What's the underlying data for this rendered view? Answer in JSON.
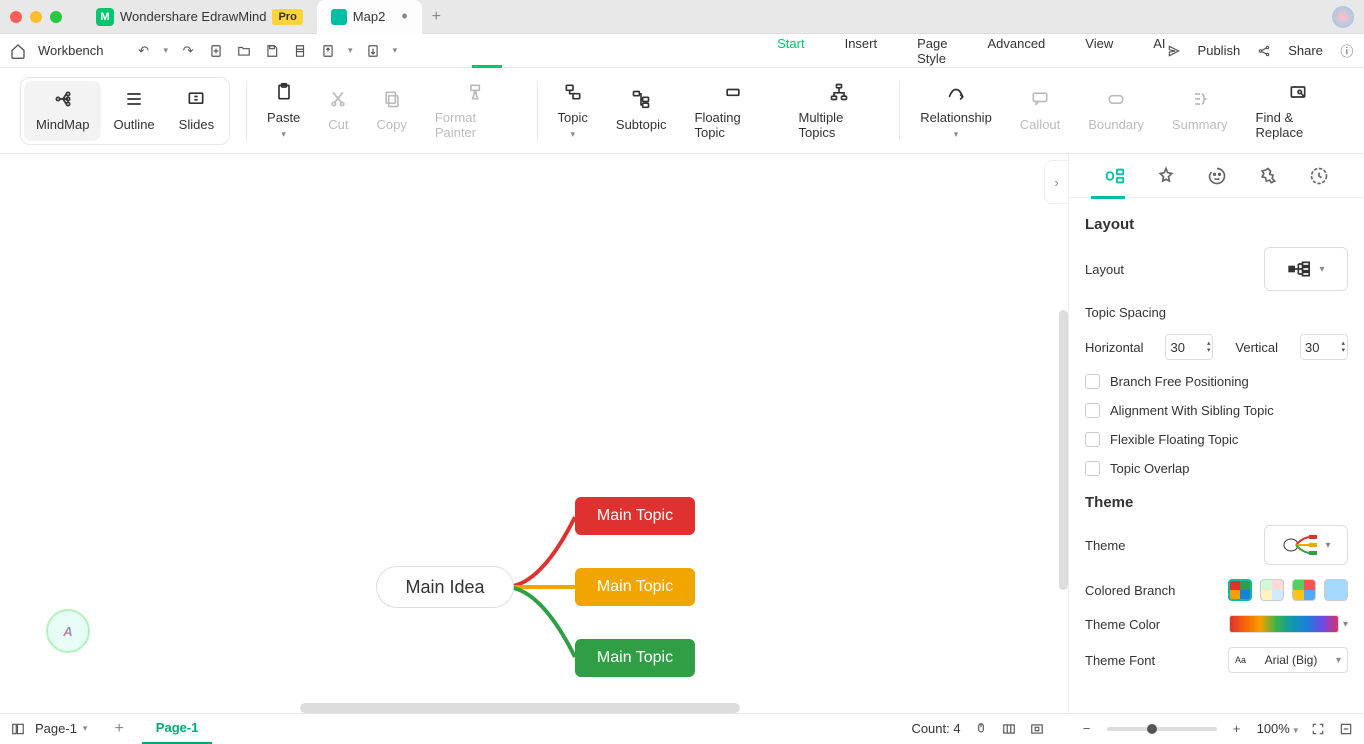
{
  "title": {
    "app": "Wondershare EdrawMind",
    "pro": "Pro",
    "doc": "Map2"
  },
  "topbar": {
    "workbench": "Workbench",
    "publish": "Publish",
    "share": "Share"
  },
  "menus": {
    "start": "Start",
    "insert": "Insert",
    "pagestyle": "Page Style",
    "advanced": "Advanced",
    "view": "View",
    "ai": "AI"
  },
  "view": {
    "mindmap": "MindMap",
    "outline": "Outline",
    "slides": "Slides"
  },
  "ribbon": {
    "paste": "Paste",
    "cut": "Cut",
    "copy": "Copy",
    "fpaint": "Format Painter",
    "topic": "Topic",
    "subtopic": "Subtopic",
    "floating": "Floating Topic",
    "multiple": "Multiple Topics",
    "relationship": "Relationship",
    "callout": "Callout",
    "boundary": "Boundary",
    "summary": "Summary",
    "find": "Find & Replace"
  },
  "mindmap": {
    "center": "Main Idea",
    "topics": [
      "Main Topic",
      "Main Topic",
      "Main Topic"
    ]
  },
  "panel": {
    "layout_title": "Layout",
    "layout_label": "Layout",
    "spacing_title": "Topic Spacing",
    "h": "Horizontal",
    "hval": "30",
    "v": "Vertical",
    "vval": "30",
    "c1": "Branch Free Positioning",
    "c2": "Alignment With Sibling Topic",
    "c3": "Flexible Floating Topic",
    "c4": "Topic Overlap",
    "theme_title": "Theme",
    "theme_label": "Theme",
    "colored": "Colored Branch",
    "tcolor": "Theme Color",
    "tfont": "Theme Font",
    "font": "Arial (Big)"
  },
  "status": {
    "page": "Page-1",
    "pagetab": "Page-1",
    "count": "Count: 4",
    "zoom": "100%"
  }
}
